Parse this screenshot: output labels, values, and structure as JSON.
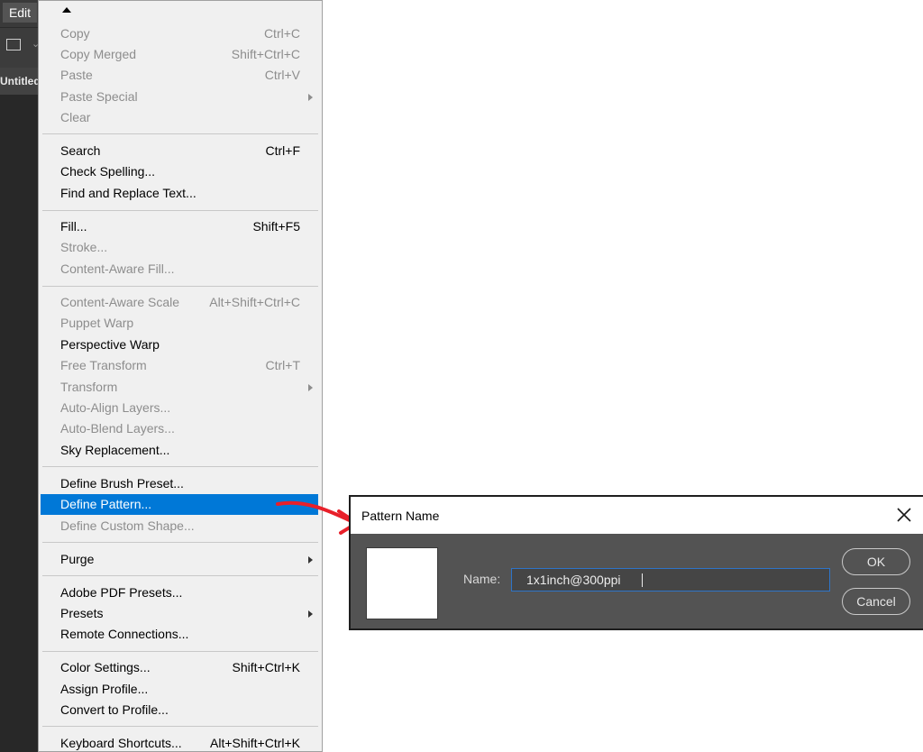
{
  "app": {
    "menu_title": "Edit",
    "doc_tab": "Untitled"
  },
  "menu": {
    "items": [
      {
        "label": "Copy",
        "shortcut": "Ctrl+C",
        "disabled": true
      },
      {
        "label": "Copy Merged",
        "shortcut": "Shift+Ctrl+C",
        "disabled": true
      },
      {
        "label": "Paste",
        "shortcut": "Ctrl+V",
        "disabled": true
      },
      {
        "label": "Paste Special",
        "shortcut": "",
        "disabled": true,
        "submenu": true
      },
      {
        "label": "Clear",
        "shortcut": "",
        "disabled": true
      },
      {
        "label": "Search",
        "shortcut": "Ctrl+F"
      },
      {
        "label": "Check Spelling...",
        "shortcut": ""
      },
      {
        "label": "Find and Replace Text...",
        "shortcut": ""
      },
      {
        "label": "Fill...",
        "shortcut": "Shift+F5"
      },
      {
        "label": "Stroke...",
        "shortcut": "",
        "disabled": true
      },
      {
        "label": "Content-Aware Fill...",
        "shortcut": "",
        "disabled": true
      },
      {
        "label": "Content-Aware Scale",
        "shortcut": "Alt+Shift+Ctrl+C",
        "disabled": true
      },
      {
        "label": "Puppet Warp",
        "shortcut": "",
        "disabled": true
      },
      {
        "label": "Perspective Warp",
        "shortcut": ""
      },
      {
        "label": "Free Transform",
        "shortcut": "Ctrl+T",
        "disabled": true
      },
      {
        "label": "Transform",
        "shortcut": "",
        "disabled": true,
        "submenu": true
      },
      {
        "label": "Auto-Align Layers...",
        "shortcut": "",
        "disabled": true
      },
      {
        "label": "Auto-Blend Layers...",
        "shortcut": "",
        "disabled": true
      },
      {
        "label": "Sky Replacement...",
        "shortcut": ""
      },
      {
        "label": "Define Brush Preset...",
        "shortcut": ""
      },
      {
        "label": "Define Pattern...",
        "shortcut": "",
        "highlighted": true
      },
      {
        "label": "Define Custom Shape...",
        "shortcut": "",
        "disabled": true
      },
      {
        "label": "Purge",
        "shortcut": "",
        "submenu": true
      },
      {
        "label": "Adobe PDF Presets...",
        "shortcut": ""
      },
      {
        "label": "Presets",
        "shortcut": "",
        "submenu": true
      },
      {
        "label": "Remote Connections...",
        "shortcut": ""
      },
      {
        "label": "Color Settings...",
        "shortcut": "Shift+Ctrl+K"
      },
      {
        "label": "Assign Profile...",
        "shortcut": ""
      },
      {
        "label": "Convert to Profile...",
        "shortcut": ""
      },
      {
        "label": "Keyboard Shortcuts...",
        "shortcut": "Alt+Shift+Ctrl+K"
      }
    ]
  },
  "dialog": {
    "title": "Pattern Name",
    "name_label": "Name:",
    "name_value": "1x1inch@300ppi",
    "ok_label": "OK",
    "cancel_label": "Cancel"
  },
  "colors": {
    "highlight": "#0078d7",
    "annotation_arrow": "#e8202a",
    "dialog_bg": "#535353"
  }
}
